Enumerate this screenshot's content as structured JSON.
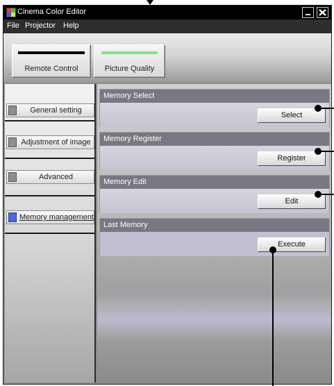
{
  "window": {
    "title": "Cinema Color Editor",
    "controls": {
      "minimize": "minimize-icon",
      "close": "close-icon"
    }
  },
  "menubar": [
    "File",
    "Projector",
    "Help"
  ],
  "toolbar": {
    "remote_control": "Remote Control",
    "picture_quality": "Picture Quality"
  },
  "sidebar": {
    "items": [
      {
        "label": "General setting"
      },
      {
        "label": "Adjustment of image"
      },
      {
        "label": "Advanced"
      },
      {
        "label": "Memory management",
        "selected": true
      }
    ]
  },
  "sections": [
    {
      "header": "Memory Select",
      "button": "Select"
    },
    {
      "header": "Memory Register",
      "button": "Register"
    },
    {
      "header": "Memory Edit",
      "button": "Edit"
    },
    {
      "header": "Last Memory",
      "button": "Execute"
    }
  ],
  "colors": {
    "titlebar": "#000000",
    "menubar": "#2e2e2e",
    "section_header": "#787882",
    "selected_indicator": "#4a68d8",
    "picture_quality_indicator": "#7ee87e"
  }
}
